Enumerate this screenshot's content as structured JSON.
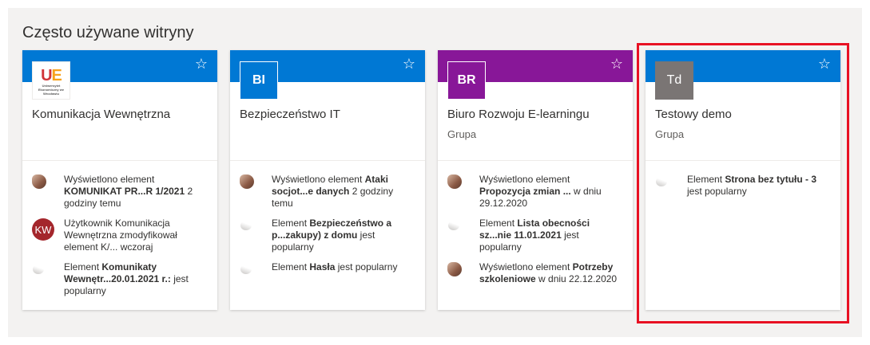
{
  "section": {
    "title": "Często używane witryny"
  },
  "colors": {
    "band_blue": "#0078d4",
    "band_purple": "#881798",
    "highlight": "#e81123"
  },
  "cards": [
    {
      "name": "Komunikacja Wewnętrzna",
      "type": "",
      "logo": {
        "kind": "university-logo",
        "mark": "UE",
        "text": "Uniwersytet Ekonomiczny we Wrocławiu"
      },
      "activities": [
        {
          "icon": "photo-avatar",
          "pre": "Wyświetlono element ",
          "bold": "KOMUNIKAT PR...R 1/2021",
          "post": " 2 godziny temu"
        },
        {
          "icon": "initials-avatar",
          "initials": "KW",
          "pre": "Użytkownik Komunikacja Wewnętrzna zmodyfikował element K/... wczoraj",
          "bold": "",
          "post": ""
        },
        {
          "icon": "file-icon",
          "pre": "Element ",
          "bold": "Komunikaty Wewnętr...20.01.2021 r.:",
          "post": " jest popularny"
        }
      ]
    },
    {
      "name": "Bezpieczeństwo IT",
      "type": "",
      "logo": {
        "kind": "initials",
        "text": "BI"
      },
      "activities": [
        {
          "icon": "photo-avatar",
          "pre": "Wyświetlono element ",
          "bold": "Ataki socjot...e danych",
          "post": " 2 godziny temu"
        },
        {
          "icon": "file-icon",
          "pre": "Element ",
          "bold": "Bezpieczeństwo a p...zakupy) z domu",
          "post": " jest popularny"
        },
        {
          "icon": "file-icon",
          "pre": "Element ",
          "bold": "Hasła",
          "post": " jest popularny"
        }
      ]
    },
    {
      "name": "Biuro Rozwoju E-learningu",
      "type": "Grupa",
      "logo": {
        "kind": "initials",
        "text": "BR"
      },
      "activities": [
        {
          "icon": "photo-avatar",
          "pre": "Wyświetlono element ",
          "bold": "Propozycja zmian ...",
          "post": " w dniu 29.12.2020"
        },
        {
          "icon": "file-icon",
          "pre": "Element ",
          "bold": "Lista obecności sz...nie 11.01.2021",
          "post": " jest popularny"
        },
        {
          "icon": "photo-avatar",
          "pre": "Wyświetlono element ",
          "bold": "Potrzeby szkoleniowe",
          "post": " w dniu 22.12.2020"
        }
      ]
    },
    {
      "name": "Testowy demo",
      "type": "Grupa",
      "logo": {
        "kind": "initials",
        "text": "Td"
      },
      "activities": [
        {
          "icon": "file-icon",
          "pre": "Element ",
          "bold": "Strona bez tytułu - 3",
          "post": " jest popularny"
        }
      ]
    }
  ],
  "star_glyph": "☆"
}
